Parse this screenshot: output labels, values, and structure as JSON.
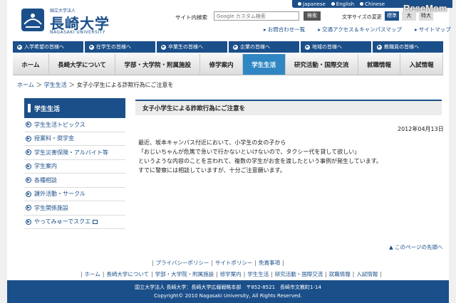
{
  "header": {
    "logo_small": "国立大学法人",
    "logo_name": "長崎大学",
    "logo_en": "NAGASAKI UNIVERSITY",
    "languages": [
      "Japanese",
      "English",
      "Chinese"
    ],
    "search_label": "サイト内検索",
    "search_placeholder": "Google カスタム検索",
    "search_button": "検索",
    "text_size_label": "文字サイズの変更",
    "text_sizes": [
      "標準",
      "大",
      "特大"
    ],
    "util_links": [
      "お問合わせ一覧",
      "交通アクセス＆キャンパスマップ",
      "サイトマップ"
    ],
    "watermark": "ReseMom"
  },
  "audience_nav": [
    "入学希望の皆様へ",
    "在学生の皆様へ",
    "卒業生の皆様へ",
    "企業の皆様へ",
    "地域の皆様へ",
    "教職員の皆様へ"
  ],
  "main_nav": [
    "ホーム",
    "長崎大学について",
    "学部・大学院・附属施設",
    "修学案内",
    "学生生活",
    "研究活動・国際交流",
    "就職情報",
    "入試情報"
  ],
  "main_nav_active": 4,
  "breadcrumb": [
    "ホーム",
    "学生生活",
    "女子小学生による詐欺行為にご注意を"
  ],
  "sidebar": {
    "title": "学生生活",
    "items": [
      "学生生活トピックス",
      "授業料・奨学金",
      "学生災害保険・アルバイト等",
      "学生案内",
      "各種相談",
      "課外活動・サークル",
      "学生関係施設",
      "やってみゅーでスクエ"
    ]
  },
  "article": {
    "title": "女子小学生による詐欺行為にご注意を",
    "date": "2012年04月13日",
    "lines": [
      "最近、坂本キャンパス付近において、小学生の女の子から",
      "「おじいちゃんが危篤で急いで行かないといけないので、タクシー代を貸して欲しい」",
      "というような内容のことを言われて、複数の学生がお金を渡したという事例が発生しています。",
      "すでに警察には相談していますが、十分ご注意願います。"
    ],
    "to_top": "このページの先頭へ"
  },
  "footer": {
    "links1": [
      "プライバシーポリシー",
      "サイトポリシー",
      "免責事項"
    ],
    "links2": [
      "ホーム",
      "長崎大学について",
      "学部・大学院・附属施設",
      "修学案内",
      "学生生活",
      "研究活動・国際交流",
      "就職情報",
      "入試情報"
    ],
    "address": "国立大学法人 長崎大学：長崎大学広報戦略本部　〒852-8521　長崎市文教町1-14",
    "copyright": "Copyright© 2010 Nagasaki University, All Rights Reserved."
  }
}
